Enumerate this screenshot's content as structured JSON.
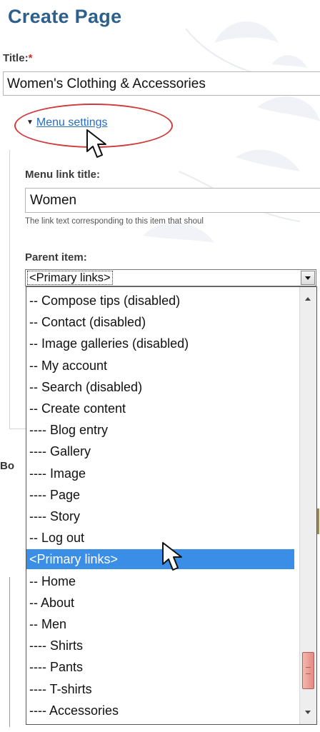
{
  "page": {
    "title": "Create Page",
    "title_label": "Title:",
    "required_marker": "*",
    "title_value": "Women's Clothing & Accessories"
  },
  "menu_settings": {
    "toggle_label": "Menu settings",
    "link_title_label": "Menu link title:",
    "link_title_value": "Women",
    "help_text": "The link text corresponding to this item that shoul",
    "parent_label": "Parent item:",
    "parent_selected": "<Primary links>"
  },
  "partial_label": "Bo",
  "dropdown_options": [
    "-- Compose tips (disabled)",
    "-- Contact (disabled)",
    "-- Image galleries (disabled)",
    "-- My account",
    "-- Search (disabled)",
    "-- Create content",
    "---- Blog entry",
    "---- Gallery",
    "---- Image",
    "---- Page",
    "---- Story",
    "-- Log out",
    "<Primary links>",
    "-- Home",
    "-- About",
    "-- Men",
    "---- Shirts",
    "---- Pants",
    "---- T-shirts",
    "---- Accessories"
  ],
  "highlighted_option": "<Primary links>",
  "colors": {
    "heading": "#2c5f8c",
    "link": "#2a6ebb",
    "selection": "#3a8ee6",
    "annotation_ellipse": "#d13a3a",
    "scrollbar_thumb": "#e58a80"
  },
  "icons": [
    "pointer-cursor-icon",
    "dropdown-arrow-icon",
    "collapse-triangle-icon"
  ]
}
